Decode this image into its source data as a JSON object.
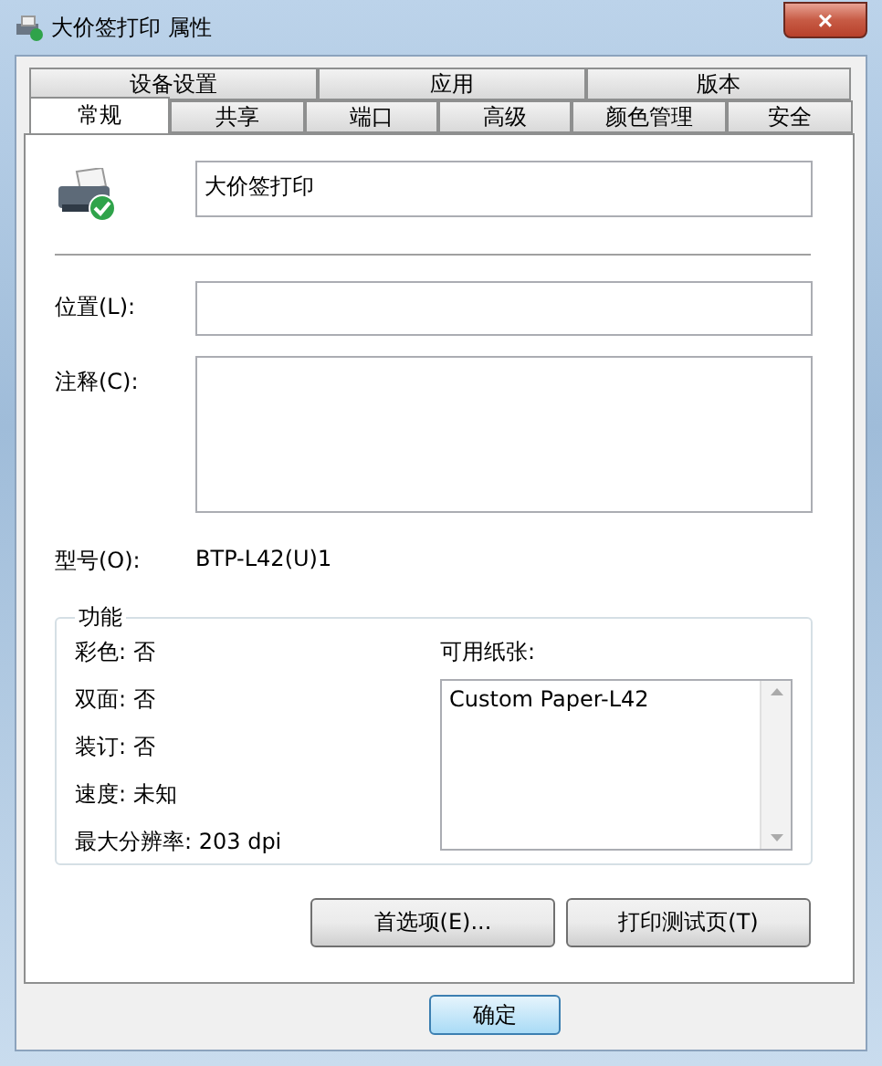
{
  "window": {
    "title": "大价签打印 属性",
    "close": "×"
  },
  "tab_rows": [
    [
      {
        "label": "设备设置",
        "selected": false
      },
      {
        "label": "应用",
        "selected": false
      },
      {
        "label": "版本",
        "selected": false
      }
    ],
    [
      {
        "label": "常规",
        "selected": true
      },
      {
        "label": "共享",
        "selected": false
      },
      {
        "label": "端口",
        "selected": false
      },
      {
        "label": "高级",
        "selected": false
      },
      {
        "label": "颜色管理",
        "selected": false
      },
      {
        "label": "安全",
        "selected": false
      }
    ]
  ],
  "printer_name": "大价签打印",
  "location": {
    "label": "位置(L):"
  },
  "comment": {
    "label": "注释(C):"
  },
  "model": {
    "label": "型号(O):",
    "value": "BTP-L42(U)1"
  },
  "features": {
    "title": "功能",
    "items": [
      "彩色: 否",
      "双面: 否",
      "装订: 否",
      "速度: 未知",
      "最大分辨率: 203 dpi"
    ],
    "paper_label": "可用纸张:",
    "papers": [
      "Custom Paper-L42"
    ]
  },
  "buttons": [
    "首选项(E)...",
    "打印测试页(T)"
  ],
  "ok": "确定"
}
